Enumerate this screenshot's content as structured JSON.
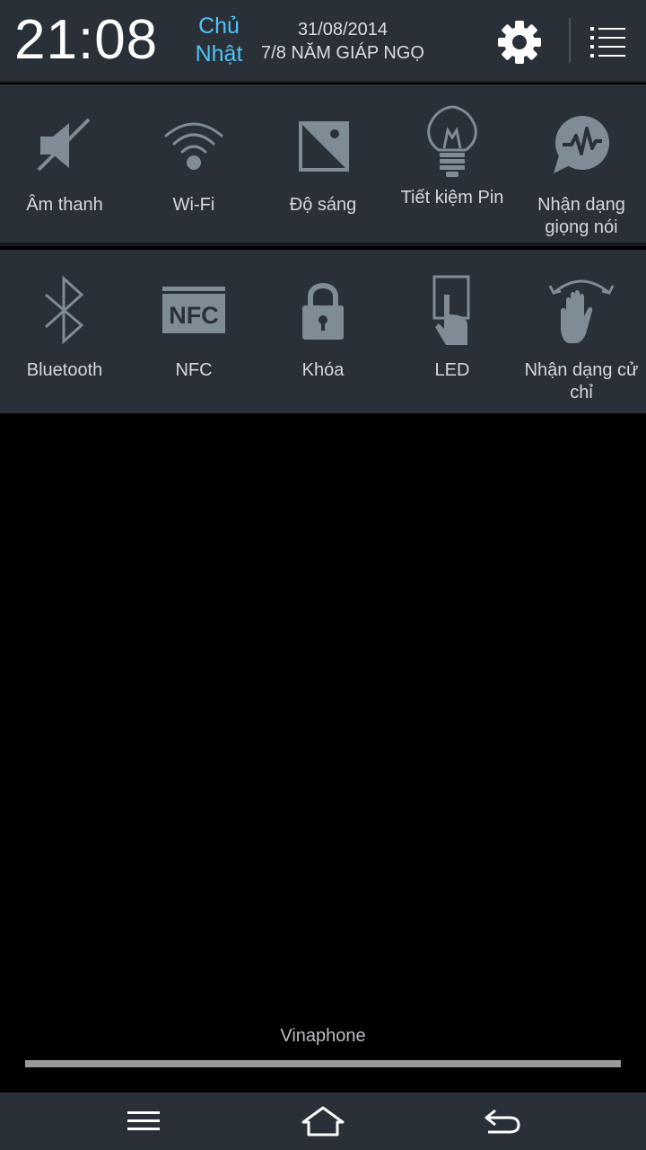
{
  "status": {
    "time": "21:08",
    "day_line1": "Chủ",
    "day_line2": "Nhật",
    "date": "31/08/2014",
    "lunar_date": "7/8 NĂM GIÁP NGỌ"
  },
  "header_icons": {
    "settings": "gear-icon",
    "menu": "list-icon"
  },
  "quick_settings_row1": [
    {
      "label": "Âm thanh",
      "icon": "sound-muted-icon"
    },
    {
      "label": "Wi-Fi",
      "icon": "wifi-icon"
    },
    {
      "label": "Độ sáng",
      "icon": "brightness-icon"
    },
    {
      "label": "Tiết kiệm Pin",
      "icon": "lightbulb-icon"
    },
    {
      "label": "Nhận dạng giọng nói",
      "icon": "voice-recognition-icon"
    }
  ],
  "quick_settings_row2": [
    {
      "label": "Bluetooth",
      "icon": "bluetooth-icon"
    },
    {
      "label": "NFC",
      "icon": "nfc-icon"
    },
    {
      "label": "Khóa",
      "icon": "lock-icon"
    },
    {
      "label": "LED",
      "icon": "led-touch-icon"
    },
    {
      "label": "Nhận dạng cử chỉ",
      "icon": "gesture-icon"
    }
  ],
  "carrier": "Vinaphone",
  "navbar": {
    "menu": "menu-icon",
    "home": "home-icon",
    "back": "back-icon"
  },
  "colors": {
    "panel": "#2a3037",
    "accent_day": "#4fc3f7",
    "icon_gray": "#7f8b95",
    "text": "#d3d8dd"
  }
}
